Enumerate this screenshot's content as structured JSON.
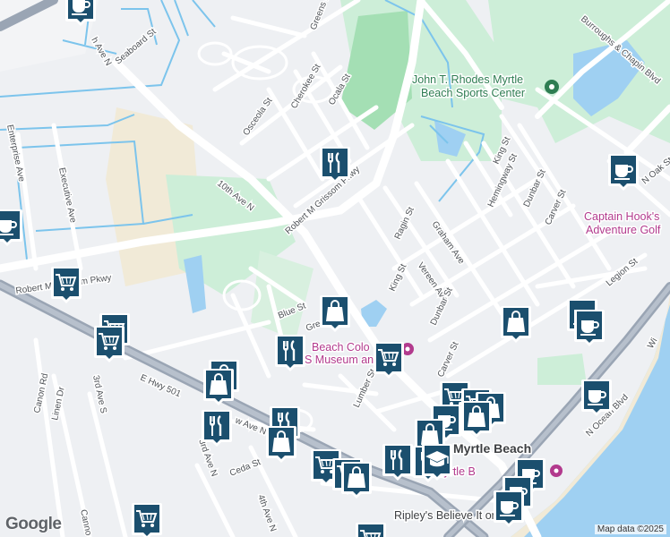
{
  "streets": {
    "seaboard": "Seaboard St",
    "greens": "Greens Blvd",
    "osceola": "Osceola St",
    "cherokee": "Cherokee St",
    "ocala": "Ocala St",
    "tenth_ave_n": "10th Ave N",
    "robert_grissom": "Robert M Grissom Pkwy",
    "robert_grissom_west": "Robert M Grissom Pkwy",
    "enterprise": "Enterprise Ave",
    "executive": "Executive Ave",
    "blue": "Blue St",
    "green": "Gre",
    "ragin": "Ragin St",
    "graham": "Graham Ave",
    "king_1": "King St",
    "king_2": "King St",
    "vereen": "Vereen Ave",
    "dunbar_1": "Dunbar St",
    "dunbar_2": "Dunbar St",
    "hemingway": "Hemingway St",
    "carver_1": "Carver St",
    "carver_2": "Carver St",
    "lumber": "Lumber St",
    "legion": "Legion St",
    "oak": "N Oak St",
    "burroughs": "Burroughs & Chapin Blvd",
    "e_hwy_501": "E Hwy 501",
    "canon": "Canon Rd",
    "linen": "Linen Dr",
    "third_ave_s": "3rd Ave S",
    "third_ave_n": "3rd Ave N",
    "fourth_ave_n": "4th Ave N",
    "cedar": "Ceda St",
    "sixth_ave_n": "w Ave N",
    "n_ocean": "N Ocean Blvd",
    "nth_ave_n": "h Ave N",
    "canno": "Canno",
    "wi": "Wi"
  },
  "pois": {
    "sports_center_line1": "John T. Rhodes Myrtle",
    "sports_center_line2": "Beach Sports Center",
    "captain_hook_line1": "Captain Hook's",
    "captain_hook_line2": "Adventure Golf",
    "museum_line1": "Beach Colo",
    "museum_line2": "S  Museum an",
    "myrtle_beach": "Myrtle Beach",
    "hotel": "K   el Myrtle B",
    "ripleys": "Ripley's Believe It or Not!"
  },
  "branding": {
    "logo": "Google",
    "attribution": "Map data ©2025"
  },
  "colors": {
    "water": "#9fd0f2",
    "park": "#cdeed8",
    "dark_park": "#a4dfb4",
    "sand": "#f1ead7",
    "road": "#ffffff",
    "highway": "#9aa5b4",
    "canal": "#7cc4ec",
    "marker": "#1b4f6e"
  },
  "markers": [
    {
      "icon": "coffee",
      "interactable": true
    },
    {
      "icon": "restaurant",
      "interactable": true
    },
    {
      "icon": "coffee",
      "interactable": true
    },
    {
      "icon": "coffee",
      "interactable": true
    },
    {
      "icon": "shopping-cart",
      "interactable": true
    },
    {
      "icon": "shopping-cart",
      "interactable": true
    },
    {
      "icon": "shopping-cart",
      "interactable": true
    },
    {
      "icon": "shopping-bag",
      "interactable": true
    },
    {
      "icon": "restaurant",
      "interactable": true
    },
    {
      "icon": "shopping-cart",
      "interactable": true
    },
    {
      "icon": "shopping-bag",
      "interactable": true
    },
    {
      "icon": "shopping-bag",
      "interactable": true
    },
    {
      "icon": "shopping-bag",
      "interactable": true
    },
    {
      "icon": "restaurant",
      "interactable": true
    },
    {
      "icon": "restaurant",
      "interactable": true
    },
    {
      "icon": "shopping-bag",
      "interactable": true
    },
    {
      "icon": "coffee",
      "interactable": true
    },
    {
      "icon": "coffee",
      "interactable": true
    },
    {
      "icon": "shopping-cart",
      "interactable": true
    },
    {
      "icon": "shopping-cart",
      "interactable": true
    },
    {
      "icon": "coffee",
      "interactable": true
    },
    {
      "icon": "coffee",
      "interactable": true
    },
    {
      "icon": "shopping-bag",
      "interactable": true
    },
    {
      "icon": "shopping-bag",
      "interactable": true
    },
    {
      "icon": "shopping-bag",
      "interactable": true
    },
    {
      "icon": "restaurant",
      "interactable": true
    },
    {
      "icon": "restaurant",
      "interactable": true
    },
    {
      "icon": "graduation-cap",
      "interactable": true
    },
    {
      "icon": "shopping-cart",
      "interactable": true
    },
    {
      "icon": "shopping-cart",
      "interactable": true
    },
    {
      "icon": "shopping-bag",
      "interactable": true
    },
    {
      "icon": "coffee",
      "interactable": true
    },
    {
      "icon": "coffee",
      "interactable": true
    },
    {
      "icon": "coffee",
      "interactable": true
    },
    {
      "icon": "shopping-cart",
      "interactable": true
    },
    {
      "icon": "shopping-cart",
      "interactable": true
    }
  ]
}
